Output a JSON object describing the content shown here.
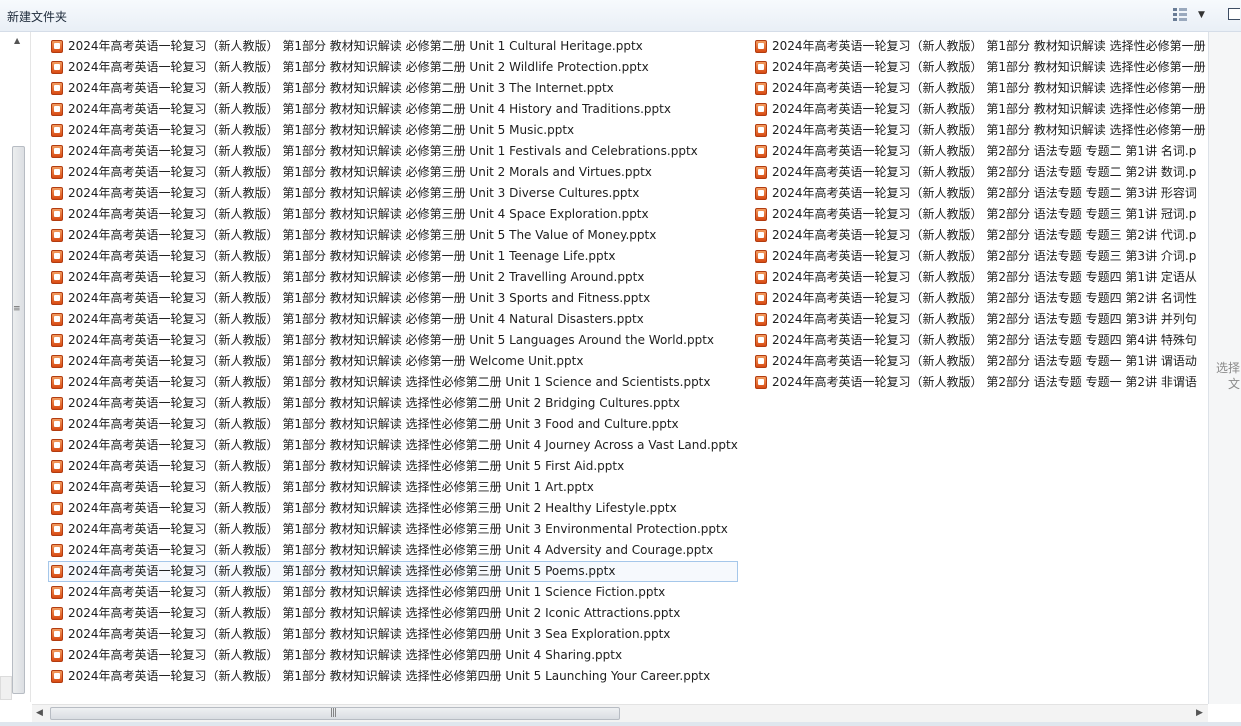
{
  "window": {
    "folder_title": "新建文件夹"
  },
  "toolbar": {
    "view_icon": "view-grid-icon",
    "view_dropdown_icon": "chevron-down-icon",
    "preview_pane_icon": "preview-pane-icon"
  },
  "details_pane": {
    "hint_line1": "选择",
    "hint_line2": "文"
  },
  "column1": [
    "2024年高考英语一轮复习（新人教版） 第1部分 教材知识解读 必修第二册 Unit 1   Cultural Heritage.pptx",
    "2024年高考英语一轮复习（新人教版） 第1部分 教材知识解读 必修第二册 Unit 2   Wildlife Protection.pptx",
    "2024年高考英语一轮复习（新人教版） 第1部分 教材知识解读 必修第二册 Unit 3   The Internet.pptx",
    "2024年高考英语一轮复习（新人教版） 第1部分 教材知识解读 必修第二册 Unit 4   History and Traditions.pptx",
    "2024年高考英语一轮复习（新人教版） 第1部分 教材知识解读 必修第二册 Unit 5   Music.pptx",
    "2024年高考英语一轮复习（新人教版） 第1部分 教材知识解读 必修第三册 Unit 1   Festivals and Celebrations.pptx",
    "2024年高考英语一轮复习（新人教版） 第1部分 教材知识解读 必修第三册 Unit 2   Morals and Virtues.pptx",
    "2024年高考英语一轮复习（新人教版） 第1部分 教材知识解读 必修第三册 Unit 3   Diverse Cultures.pptx",
    "2024年高考英语一轮复习（新人教版） 第1部分 教材知识解读 必修第三册 Unit 4   Space Exploration.pptx",
    "2024年高考英语一轮复习（新人教版） 第1部分 教材知识解读 必修第三册 Unit 5   The Value of Money.pptx",
    "2024年高考英语一轮复习（新人教版） 第1部分 教材知识解读 必修第一册 Unit 1   Teenage Life.pptx",
    "2024年高考英语一轮复习（新人教版） 第1部分 教材知识解读 必修第一册 Unit 2   Travelling Around.pptx",
    "2024年高考英语一轮复习（新人教版） 第1部分 教材知识解读 必修第一册 Unit 3   Sports and Fitness.pptx",
    "2024年高考英语一轮复习（新人教版） 第1部分 教材知识解读 必修第一册 Unit 4   Natural Disasters.pptx",
    "2024年高考英语一轮复习（新人教版） 第1部分 教材知识解读 必修第一册 Unit 5   Languages Around the World.pptx",
    "2024年高考英语一轮复习（新人教版） 第1部分 教材知识解读 必修第一册 Welcome Unit.pptx",
    "2024年高考英语一轮复习（新人教版） 第1部分 教材知识解读 选择性必修第二册 Unit 1   Science and Scientists.pptx",
    "2024年高考英语一轮复习（新人教版） 第1部分 教材知识解读 选择性必修第二册 Unit 2   Bridging Cultures.pptx",
    "2024年高考英语一轮复习（新人教版） 第1部分 教材知识解读 选择性必修第二册 Unit 3   Food and Culture.pptx",
    "2024年高考英语一轮复习（新人教版） 第1部分 教材知识解读 选择性必修第二册 Unit 4  Journey Across a Vast Land.pptx",
    "2024年高考英语一轮复习（新人教版） 第1部分 教材知识解读 选择性必修第二册 Unit 5   First Aid.pptx",
    "2024年高考英语一轮复习（新人教版） 第1部分 教材知识解读 选择性必修第三册 Unit 1   Art.pptx",
    "2024年高考英语一轮复习（新人教版） 第1部分 教材知识解读 选择性必修第三册 Unit 2   Healthy Lifestyle.pptx",
    "2024年高考英语一轮复习（新人教版） 第1部分 教材知识解读 选择性必修第三册 Unit 3   Environmental Protection.pptx",
    "2024年高考英语一轮复习（新人教版） 第1部分 教材知识解读 选择性必修第三册 Unit 4  Adversity and Courage.pptx",
    "2024年高考英语一轮复习（新人教版） 第1部分 教材知识解读 选择性必修第三册 Unit 5   Poems.pptx",
    "2024年高考英语一轮复习（新人教版） 第1部分 教材知识解读 选择性必修第四册 Unit 1   Science Fiction.pptx",
    "2024年高考英语一轮复习（新人教版） 第1部分 教材知识解读 选择性必修第四册 Unit 2   Iconic Attractions.pptx",
    "2024年高考英语一轮复习（新人教版） 第1部分 教材知识解读 选择性必修第四册 Unit 3   Sea Exploration.pptx",
    "2024年高考英语一轮复习（新人教版） 第1部分 教材知识解读 选择性必修第四册 Unit 4   Sharing.pptx",
    "2024年高考英语一轮复习（新人教版） 第1部分 教材知识解读 选择性必修第四册 Unit 5   Launching Your Career.pptx"
  ],
  "selected_index": 25,
  "column2": [
    "2024年高考英语一轮复习（新人教版） 第1部分 教材知识解读 选择性必修第一册",
    "2024年高考英语一轮复习（新人教版） 第1部分 教材知识解读 选择性必修第一册",
    "2024年高考英语一轮复习（新人教版） 第1部分 教材知识解读 选择性必修第一册",
    "2024年高考英语一轮复习（新人教版） 第1部分 教材知识解读 选择性必修第一册",
    "2024年高考英语一轮复习（新人教版） 第1部分 教材知识解读 选择性必修第一册",
    "2024年高考英语一轮复习（新人教版） 第2部分 语法专题 专题二   第1讲   名词.p",
    "2024年高考英语一轮复习（新人教版） 第2部分 语法专题 专题二   第2讲   数词.p",
    "2024年高考英语一轮复习（新人教版） 第2部分 语法专题 专题二   第3讲   形容词",
    "2024年高考英语一轮复习（新人教版） 第2部分 语法专题 专题三   第1讲   冠词.p",
    "2024年高考英语一轮复习（新人教版） 第2部分 语法专题 专题三   第2讲   代词.p",
    "2024年高考英语一轮复习（新人教版） 第2部分 语法专题 专题三   第3讲   介词.p",
    "2024年高考英语一轮复习（新人教版） 第2部分 语法专题 专题四   第1讲   定语从",
    "2024年高考英语一轮复习（新人教版） 第2部分 语法专题 专题四   第2讲   名词性",
    "2024年高考英语一轮复习（新人教版） 第2部分 语法专题 专题四   第3讲   并列句",
    "2024年高考英语一轮复习（新人教版） 第2部分 语法专题 专题四   第4讲   特殊句",
    "2024年高考英语一轮复习（新人教版） 第2部分 语法专题 专题一   第1讲   谓语动",
    "2024年高考英语一轮复习（新人教版） 第2部分 语法专题 专题一   第2讲   非谓语"
  ]
}
